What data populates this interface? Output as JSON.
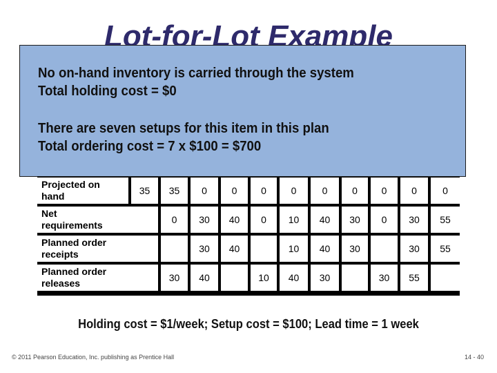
{
  "slide": {
    "title": "Lot-for-Lot Example",
    "callout": {
      "lines": [
        "No on-hand inventory is carried through the system",
        "Total holding cost = $0",
        "There are seven setups for this item in this plan",
        "Total ordering cost = 7 x $100 = $700"
      ]
    },
    "table": {
      "rows": [
        {
          "label": "Projected on hand",
          "label_line1": "Projected on",
          "label_line2": "hand",
          "past_due": "35",
          "values": [
            "35",
            "0",
            "0",
            "0",
            "0",
            "0",
            "0",
            "0",
            "0",
            "0"
          ]
        },
        {
          "label": "Net requirements",
          "label_line1": "Net",
          "label_line2": "requirements",
          "values": [
            "0",
            "30",
            "40",
            "0",
            "10",
            "40",
            "30",
            "0",
            "30",
            "55"
          ]
        },
        {
          "label": "Planned order receipts",
          "label_line1": "Planned order",
          "label_line2": "receipts",
          "values": [
            "",
            "30",
            "40",
            "",
            "10",
            "40",
            "30",
            "",
            "30",
            "55"
          ]
        },
        {
          "label": "Planned order releases",
          "label_line1": "Planned order",
          "label_line2": "releases",
          "values": [
            "30",
            "40",
            "",
            "10",
            "40",
            "30",
            "",
            "30",
            "55",
            ""
          ]
        }
      ]
    },
    "footnote": "Holding cost = $1/week; Setup cost = $100; Lead time = 1 week",
    "copyright": "© 2011 Pearson Education, Inc. publishing as Prentice Hall",
    "slide_number": "14 - 40"
  },
  "colors": {
    "callout_background": "#95b3dc",
    "title": "#2e2a6b"
  }
}
